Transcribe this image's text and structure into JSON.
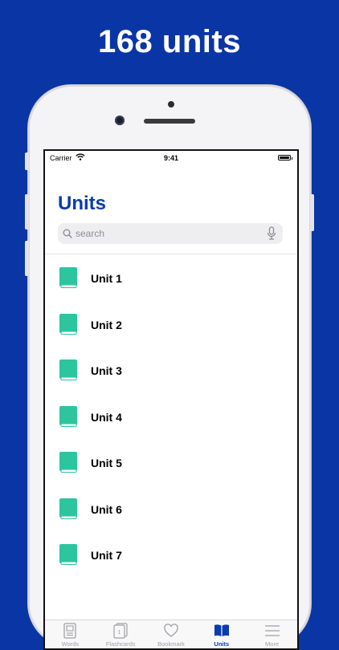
{
  "headline": "168 units",
  "status_bar": {
    "carrier": "Carrier",
    "time": "9:41"
  },
  "page": {
    "title": "Units"
  },
  "search": {
    "placeholder": "search"
  },
  "units": [
    "Unit 1",
    "Unit 2",
    "Unit 3",
    "Unit 4",
    "Unit 5",
    "Unit 6",
    "Unit 7"
  ],
  "tabs": [
    {
      "label": "Words",
      "icon": "words-icon"
    },
    {
      "label": "Flashcards",
      "icon": "flashcards-icon"
    },
    {
      "label": "Bookmark",
      "icon": "heart-icon"
    },
    {
      "label": "Units",
      "icon": "book-icon",
      "active": true
    },
    {
      "label": "More",
      "icon": "menu-icon"
    }
  ],
  "colors": {
    "background": "#0a35a5",
    "accent": "#0a3bb0",
    "book": "#2dc5a0",
    "tab_inactive": "#a0a0a6"
  }
}
